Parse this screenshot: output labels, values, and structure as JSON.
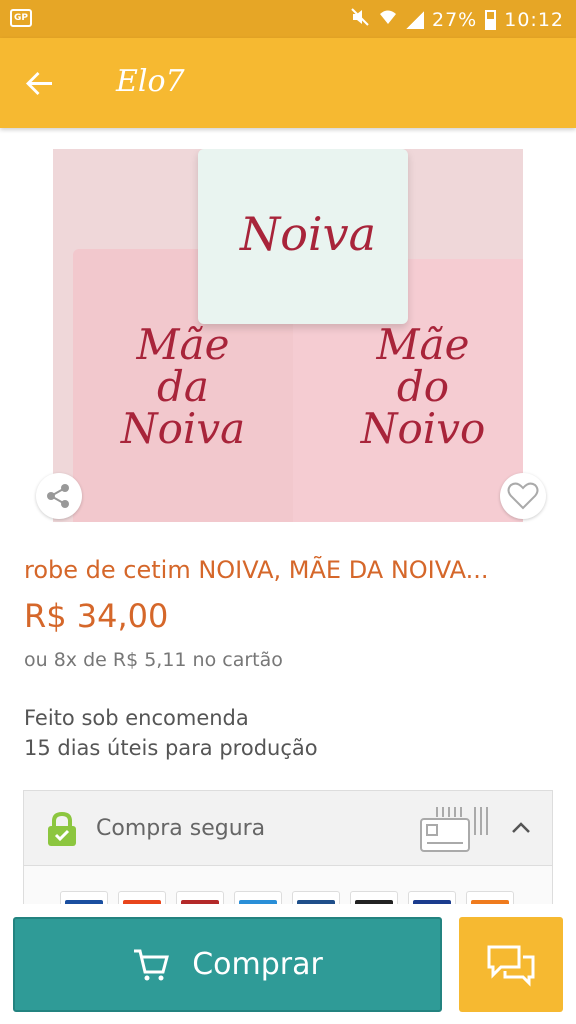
{
  "status_bar": {
    "left_icon": "app-notification-icon",
    "battery": "27%",
    "time": "10:12"
  },
  "app_bar": {
    "back_icon": "arrow-back-icon",
    "title": "Elo7"
  },
  "product": {
    "image": {
      "embroidery_top": "Noiva",
      "embroidery_left": [
        "Mãe",
        "da",
        "Noiva"
      ],
      "embroidery_right": [
        "Mãe",
        "do",
        "Noivo"
      ]
    },
    "title": "robe de cetim NOIVA, MÃE DA NOIVA...",
    "price": "R$ 34,00",
    "installments": "ou 8x de R$ 5,11 no cartão",
    "made_to_order": "Feito sob encomenda",
    "production_time": "15 dias úteis para produção"
  },
  "secure_purchase": {
    "label": "Compra segura",
    "icon": "lock-icon",
    "card_icon": "card-icon",
    "expanded": true,
    "payment_methods": [
      "VISA",
      "mastercard",
      "diners",
      "amex",
      "paypal",
      "elo",
      "hipercard",
      "boleto"
    ]
  },
  "actions": {
    "buy_label": "Comprar",
    "buy_icon": "cart-icon",
    "chat_icon": "chat-icon"
  },
  "colors": {
    "status_bar": "#e6a626",
    "app_bar": "#f6b931",
    "accent": "#d5672a",
    "buy_button": "#2f9b97",
    "chat_button": "#f6b931"
  }
}
